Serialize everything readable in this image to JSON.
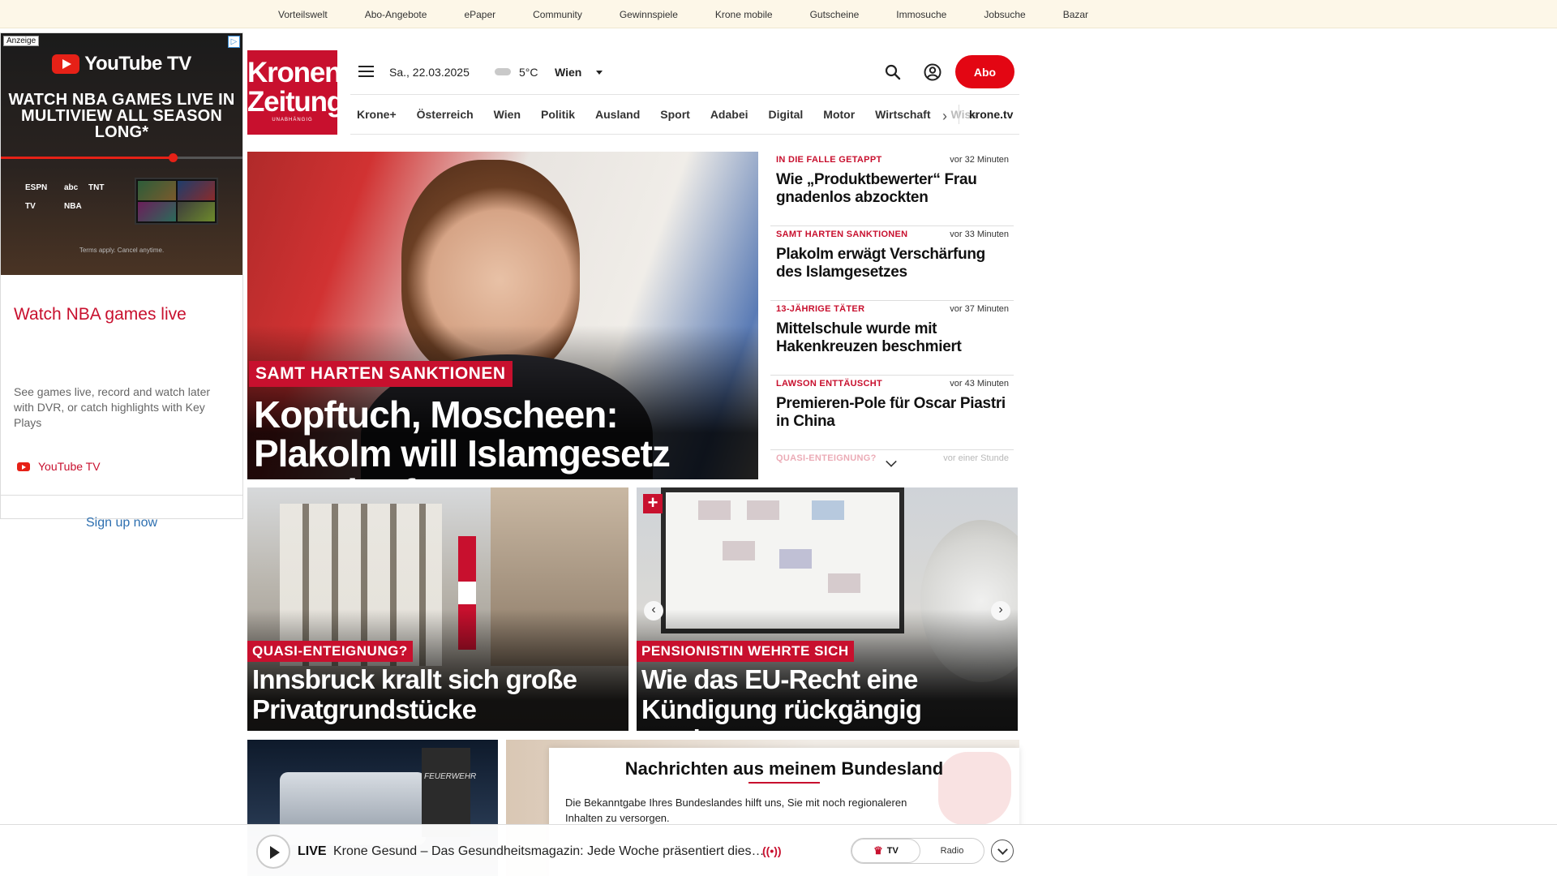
{
  "topbar": {
    "links": [
      "Vorteilswelt",
      "Abo-Angebote",
      "ePaper",
      "Community",
      "Gewinnspiele",
      "Krone mobile",
      "Gutscheine",
      "Immosuche",
      "Jobsuche",
      "Bazar"
    ]
  },
  "ad": {
    "label": "Anzeige",
    "brand_logo": "YouTube TV",
    "headline": "WATCH NBA GAMES LIVE IN MULTIVIEW ALL SEASON LONG*",
    "progress_fraction": 0.71,
    "network_logos": [
      "ESPN",
      "abc",
      "TNT",
      "TV",
      "NBA"
    ],
    "terms": "Terms apply. Cancel anytime.",
    "title": "Watch NBA games live",
    "description": "See games live, record and watch later with DVR, or catch highlights with Key Plays",
    "advertiser": "YouTube TV",
    "cta": "Sign up now"
  },
  "header": {
    "logo_line1": "Kronen",
    "logo_line2": "Zeitung",
    "logo_tagline": "UNABHÄNGIG",
    "date": "Sa., 22.03.2025",
    "temperature": "5°C",
    "city": "Wien",
    "abo_label": "Abo",
    "icons": [
      "menu-icon",
      "cloud-icon",
      "search-icon",
      "user-icon"
    ]
  },
  "nav": {
    "items": [
      "Krone+",
      "Österreich",
      "Wien",
      "Politik",
      "Ausland",
      "Sport",
      "Adabei",
      "Digital",
      "Motor",
      "Wirtschaft"
    ],
    "truncated_item": "Wiss",
    "kronetv": "krone.tv"
  },
  "hero": {
    "kicker": "SAMT HARTEN SANKTIONEN",
    "title": "Kopftuch, Moscheen: Plakolm will Islamgesetz verschärfen"
  },
  "side_news": [
    {
      "category": "IN DIE FALLE GETAPPT",
      "time": "vor 32 Minuten",
      "headline": "Wie „Produktbewerter“ Frau gnadenlos abzockten"
    },
    {
      "category": "SAMT HARTEN SANKTIONEN",
      "time": "vor 33 Minuten",
      "headline": "Plakolm erwägt Verschärfung des Islamgesetzes"
    },
    {
      "category": "13-JÄHRIGE TÄTER",
      "time": "vor 37 Minuten",
      "headline": "Mittelschule wurde mit Hakenkreuzen beschmiert"
    },
    {
      "category": "LAWSON ENTTÄUSCHT",
      "time": "vor 43 Minuten",
      "headline": "Premieren-Pole für Oscar Piastri in China"
    },
    {
      "category": "QUASI-ENTEIGNUNG?",
      "time": "vor einer Stunde",
      "headline": ""
    }
  ],
  "cards": [
    {
      "kicker": "QUASI-ENTEIGNUNG?",
      "title": "Innsbruck krallt sich große Privatgrundstücke"
    },
    {
      "kicker": "PENSIONISTIN WEHRTE SICH",
      "title": "Wie das EU-Recht eine Kündigung rückgängig machte"
    }
  ],
  "row3": {
    "vehicle_text": "FEUERWEHR"
  },
  "bundesland_modal": {
    "title": "Nachrichten aus meinem Bundesland",
    "text": "Die Bekanntgabe Ihres Bundeslandes hilft uns, Sie mit noch regionaleren Inhalten zu versorgen."
  },
  "livebar": {
    "live_label": "LIVE",
    "now_playing": "Krone Gesund – Das Gesundheitsmagazin: Jede Woche präsentiert dies…",
    "tv_label": "TV",
    "radio_label": "Radio"
  },
  "colors": {
    "brand_red": "#c8102e",
    "abo_red": "#e30613",
    "topbar_bg": "#fdf7e8"
  }
}
